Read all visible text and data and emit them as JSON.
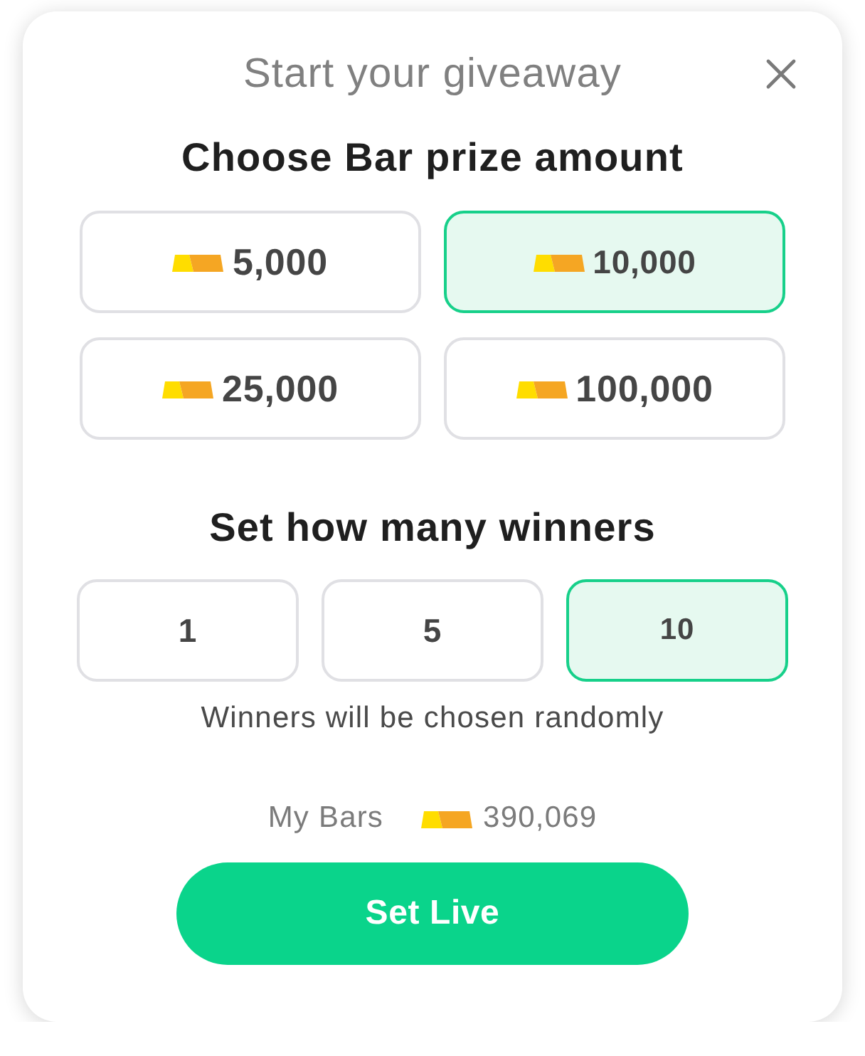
{
  "dialog": {
    "title": "Start your giveaway"
  },
  "prize_section": {
    "heading": "Choose Bar prize amount",
    "options": [
      {
        "amount": "5,000",
        "selected": false
      },
      {
        "amount": "10,000",
        "selected": true
      },
      {
        "amount": "25,000",
        "selected": false
      },
      {
        "amount": "100,000",
        "selected": false
      }
    ]
  },
  "winners_section": {
    "heading": "Set how many winners",
    "options": [
      {
        "count": "1",
        "selected": false
      },
      {
        "count": "5",
        "selected": false
      },
      {
        "count": "10",
        "selected": true
      }
    ],
    "note": "Winners will be chosen randomly"
  },
  "balance": {
    "label": "My Bars",
    "amount": "390,069"
  },
  "primary_button": {
    "label": "Set Live"
  }
}
